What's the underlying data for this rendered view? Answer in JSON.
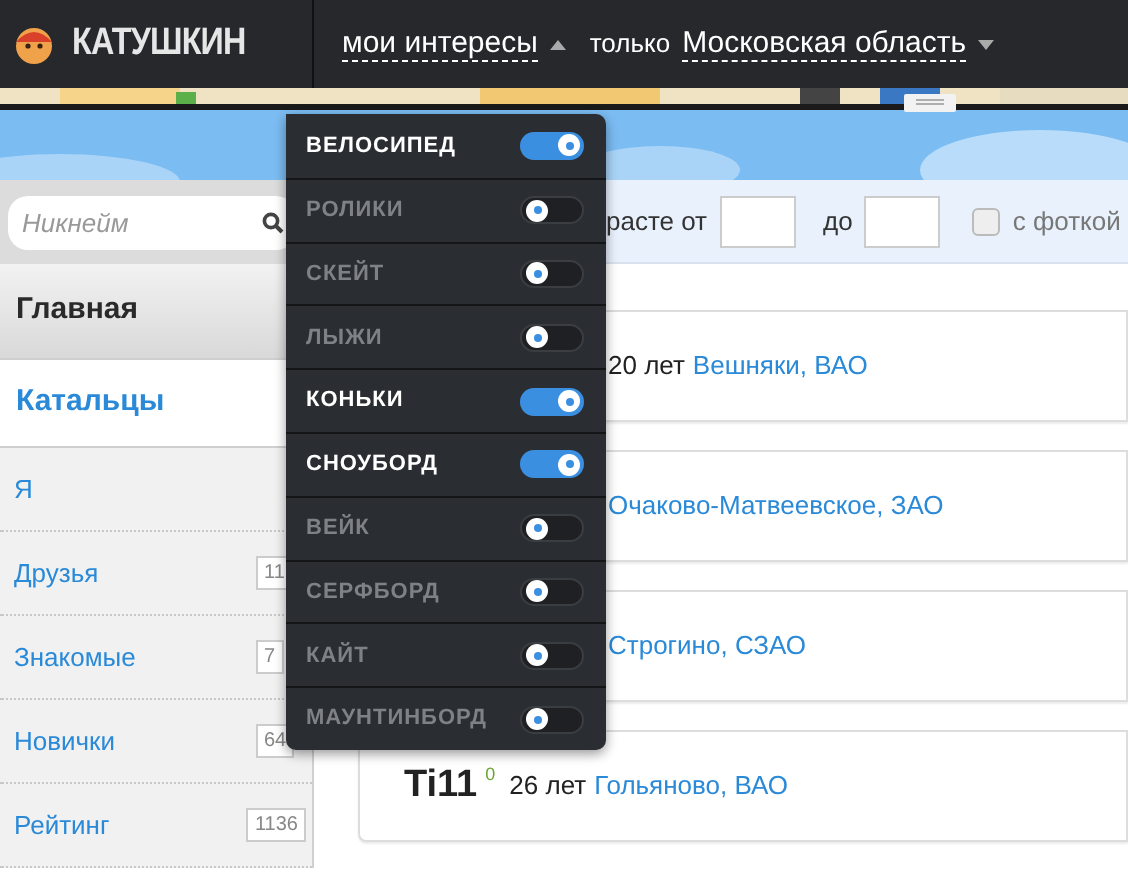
{
  "header": {
    "logo_text": "КАТУШКИН",
    "interests": "мои интересы",
    "only_label": "только",
    "region": "Московская область"
  },
  "sidebar": {
    "search": {
      "placeholder": "Никнейм"
    },
    "items": [
      {
        "label": "Главная",
        "kind": "section",
        "selected": false
      },
      {
        "label": "Катальцы",
        "kind": "section",
        "selected": true
      },
      {
        "label": "Я",
        "kind": "link",
        "selected": false
      },
      {
        "label": "Друзья",
        "kind": "link",
        "count": "11",
        "selected": false
      },
      {
        "label": "Знакомые",
        "kind": "link",
        "count": "7",
        "selected": false
      },
      {
        "label": "Новички",
        "kind": "link",
        "count": "64",
        "selected": false
      },
      {
        "label": "Рейтинг",
        "kind": "link",
        "count": "1136",
        "selected": false
      }
    ]
  },
  "filter": {
    "age_from_label": "расте от",
    "age_to_label": "до",
    "photo_label": "с фоткой",
    "photo_checked": false
  },
  "users": [
    {
      "kind": "partial",
      "age": "20 лет",
      "location": "Вешняки, ВАО"
    },
    {
      "kind": "partial",
      "location": "Очаково-Матвеевское, ЗАО"
    },
    {
      "kind": "partial",
      "location": "Строгино, СЗАО"
    },
    {
      "kind": "full",
      "name": "Ti11",
      "rating": "0",
      "age": "26 лет",
      "location": "Гольяново, ВАО"
    }
  ],
  "interests_menu": [
    {
      "label": "ВЕЛОСИПЕД",
      "on": true
    },
    {
      "label": "РОЛИКИ",
      "on": false
    },
    {
      "label": "СКЕЙТ",
      "on": false
    },
    {
      "label": "ЛЫЖИ",
      "on": false
    },
    {
      "label": "КОНЬКИ",
      "on": true
    },
    {
      "label": "СНОУБОРД",
      "on": true
    },
    {
      "label": "ВЕЙК",
      "on": false
    },
    {
      "label": "СЕРФБОРД",
      "on": false
    },
    {
      "label": "КАЙТ",
      "on": false
    },
    {
      "label": "МАУНТИНБОРД",
      "on": false
    }
  ]
}
